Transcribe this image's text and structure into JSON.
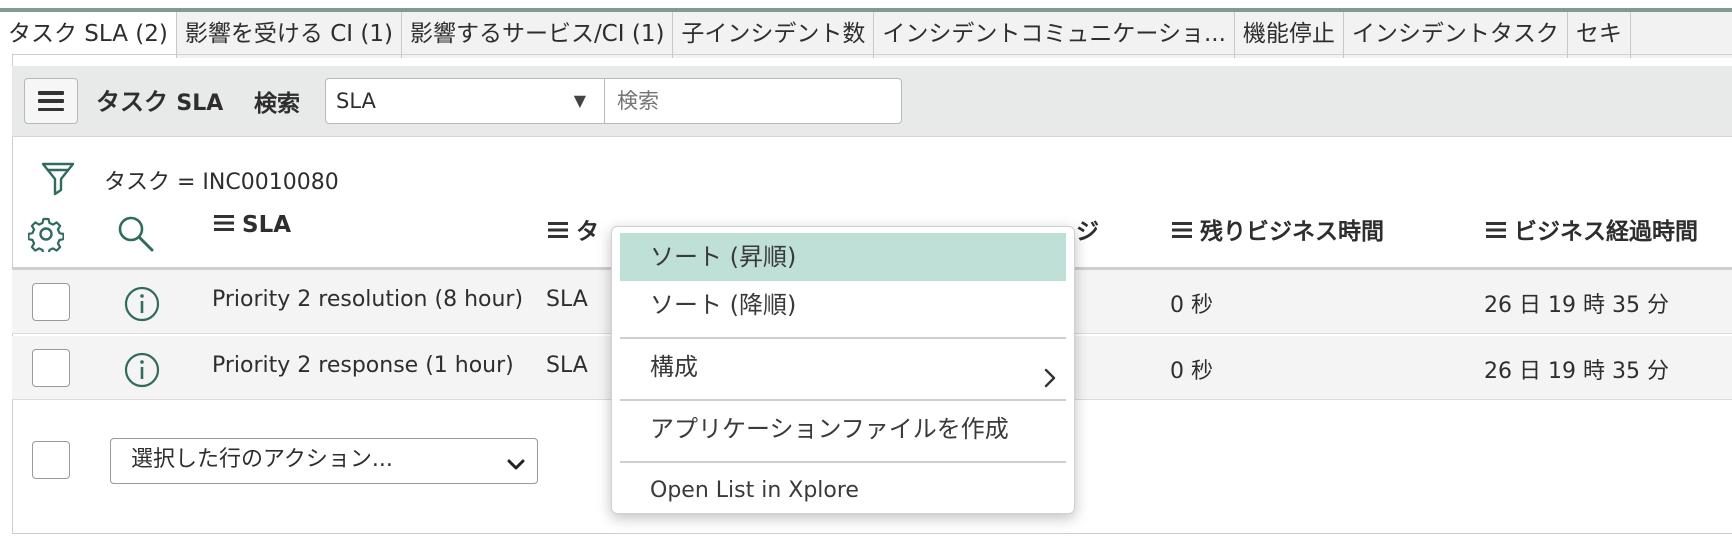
{
  "tabs": [
    {
      "label": "タスク SLA (2)",
      "active": true
    },
    {
      "label": "影響を受ける CI (1)",
      "active": false
    },
    {
      "label": "影響するサービス/CI (1)",
      "active": false
    },
    {
      "label": "子インシデント数",
      "active": false
    },
    {
      "label": "インシデントコミュニケーショ...",
      "active": false
    },
    {
      "label": "機能停止",
      "active": false
    },
    {
      "label": "インシデントタスク",
      "active": false
    },
    {
      "label": "セキ",
      "active": false
    }
  ],
  "toolbar": {
    "title_main": "タスク",
    "title_sub": "SLA",
    "search_label": "検索",
    "select_value": "SLA",
    "search_placeholder": "検索"
  },
  "filter": {
    "text": "タスク = INC0010080"
  },
  "columns": {
    "sla": "SLA",
    "type": "タ",
    "stage": "ジ",
    "remaining": "残りビジネス時間",
    "elapsed": "ビジネス経過時間"
  },
  "rows": [
    {
      "sla": "Priority 2 resolution (8 hour)",
      "type": "SLA",
      "remaining": "0 秒",
      "elapsed": "26 日 19 時 35 分"
    },
    {
      "sla": "Priority 2 response (1 hour)",
      "type": "SLA",
      "remaining": "0 秒",
      "elapsed": "26 日 19 時 35 分"
    }
  ],
  "bulk_action": {
    "label": "選択した行のアクション..."
  },
  "context_menu": {
    "sort_asc": "ソート (昇順)",
    "sort_desc": "ソート (降順)",
    "configure": "構成",
    "create_app_file": "アプリケーションファイルを作成",
    "open_xplore": "Open List in Xplore"
  },
  "colors": {
    "accent": "#2e6d5e",
    "highlight": "#bfe0d6",
    "toolbar_bg": "#e8eaea"
  }
}
